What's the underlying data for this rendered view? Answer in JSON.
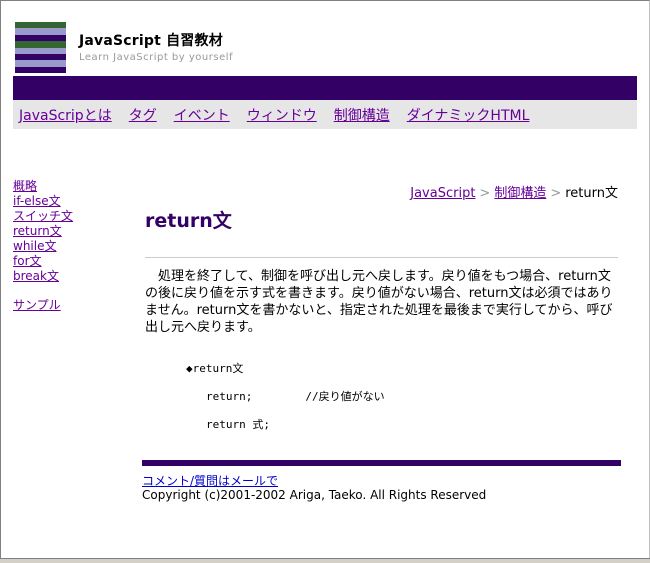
{
  "header": {
    "title": "JavaScript 自習教材",
    "subtitle": "Learn JavaScript by yourself",
    "logo_stripes": [
      "#336633",
      "#9999cc",
      "#330066",
      "#336633",
      "#9999cc",
      "#330066",
      "#9999cc",
      "#330066"
    ]
  },
  "nav": {
    "items": [
      "JavaScripとは",
      "タグ",
      "イベント",
      "ウィンドウ",
      "制御構造",
      "ダイナミックHTML"
    ]
  },
  "sidebar": {
    "items": [
      "概略",
      "if-else文",
      "スイッチ文",
      "return文",
      "while文",
      "for文",
      "break文"
    ],
    "sample": "サンプル"
  },
  "breadcrumb": {
    "items": [
      "JavaScript",
      "制御構造"
    ],
    "current": "return文",
    "separator": ">"
  },
  "main": {
    "title": "return文",
    "description": "処理を終了して、制御を呼び出し元へ戻します。戻り値をもつ場合、return文の後に戻り値を示す式を書きます。戻り値がない場合、return文は必須ではありません。return文を書かないと、指定された処理を最後まで実行してから、呼び出し元へ戻ります。",
    "code": {
      "heading": "◆return文",
      "line1": "return;        //戻り値がない",
      "line2": "return 式;"
    }
  },
  "footer": {
    "contact": "コメント/質問はメールで",
    "copyright": "Copyright (c)2001-2002 Ariga, Taeko.  All Rights Reserved"
  },
  "colors": {
    "accent": "#330066",
    "link": "#660099",
    "nav_bg": "#e6e6e6"
  }
}
